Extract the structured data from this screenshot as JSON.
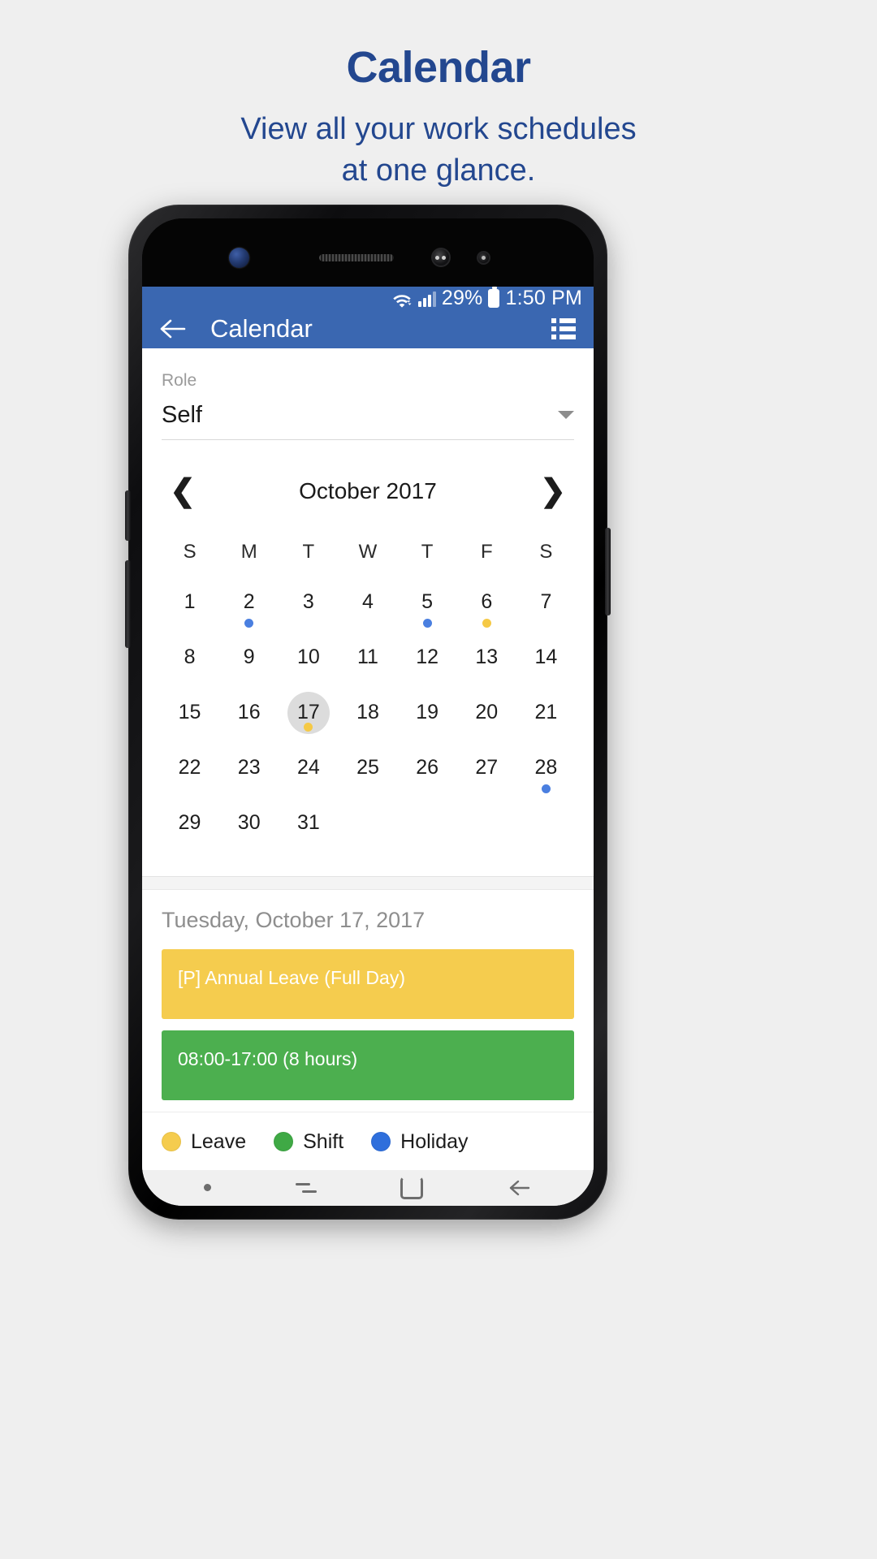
{
  "promo": {
    "title": "Calendar",
    "subtitle_line1": "View all your work schedules",
    "subtitle_line2": "at one glance.",
    "title_color": "#23478f"
  },
  "status_bar": {
    "battery_percent": "29%",
    "time": "1:50 PM",
    "wifi_icon": "wifi-icon",
    "signal_icon": "signal-icon",
    "battery_icon": "battery-icon",
    "background": "#3a67b1"
  },
  "app_bar": {
    "title": "Calendar",
    "back_icon": "arrow-left-icon",
    "list_view_icon": "list-view-icon",
    "background": "#3a67b1"
  },
  "role_selector": {
    "label": "Role",
    "value": "Self",
    "dropdown_icon": "chevron-down-icon"
  },
  "calendar": {
    "month_title": "October 2017",
    "prev_icon": "chevron-left-icon",
    "next_icon": "chevron-right-icon",
    "weekday_headers": [
      "S",
      "M",
      "T",
      "W",
      "T",
      "F",
      "S"
    ],
    "selected_day": 17,
    "weeks": [
      [
        {
          "day": "1"
        },
        {
          "day": "2",
          "marker": "blue"
        },
        {
          "day": "3"
        },
        {
          "day": "4"
        },
        {
          "day": "5",
          "marker": "blue"
        },
        {
          "day": "6",
          "marker": "yellow"
        },
        {
          "day": "7"
        }
      ],
      [
        {
          "day": "8"
        },
        {
          "day": "9"
        },
        {
          "day": "10"
        },
        {
          "day": "11"
        },
        {
          "day": "12"
        },
        {
          "day": "13"
        },
        {
          "day": "14"
        }
      ],
      [
        {
          "day": "15"
        },
        {
          "day": "16"
        },
        {
          "day": "17",
          "marker": "yellow",
          "selected": true
        },
        {
          "day": "18"
        },
        {
          "day": "19"
        },
        {
          "day": "20"
        },
        {
          "day": "21"
        }
      ],
      [
        {
          "day": "22"
        },
        {
          "day": "23"
        },
        {
          "day": "24"
        },
        {
          "day": "25"
        },
        {
          "day": "26"
        },
        {
          "day": "27"
        },
        {
          "day": "28",
          "marker": "blue"
        }
      ],
      [
        {
          "day": "29"
        },
        {
          "day": "30"
        },
        {
          "day": "31"
        },
        {
          "day": ""
        },
        {
          "day": ""
        },
        {
          "day": ""
        },
        {
          "day": ""
        }
      ]
    ]
  },
  "day_detail": {
    "selected_date_label": "Tuesday, October 17, 2017",
    "events": [
      {
        "text": "[P] Annual Leave (Full Day)",
        "type": "leave",
        "color": "#f5cc4e"
      },
      {
        "text": "08:00-17:00 (8 hours)",
        "type": "shift",
        "color": "#4caf4f"
      }
    ]
  },
  "legend": {
    "items": [
      {
        "label": "Leave",
        "color": "#f5cc4e"
      },
      {
        "label": "Shift",
        "color": "#3fa945"
      },
      {
        "label": "Holiday",
        "color": "#2f6fdc"
      }
    ]
  },
  "nav_bar": {
    "dot_icon": "dot-icon",
    "recents_icon": "recents-icon",
    "home_icon": "home-icon",
    "back_icon": "back-arrow-icon"
  }
}
